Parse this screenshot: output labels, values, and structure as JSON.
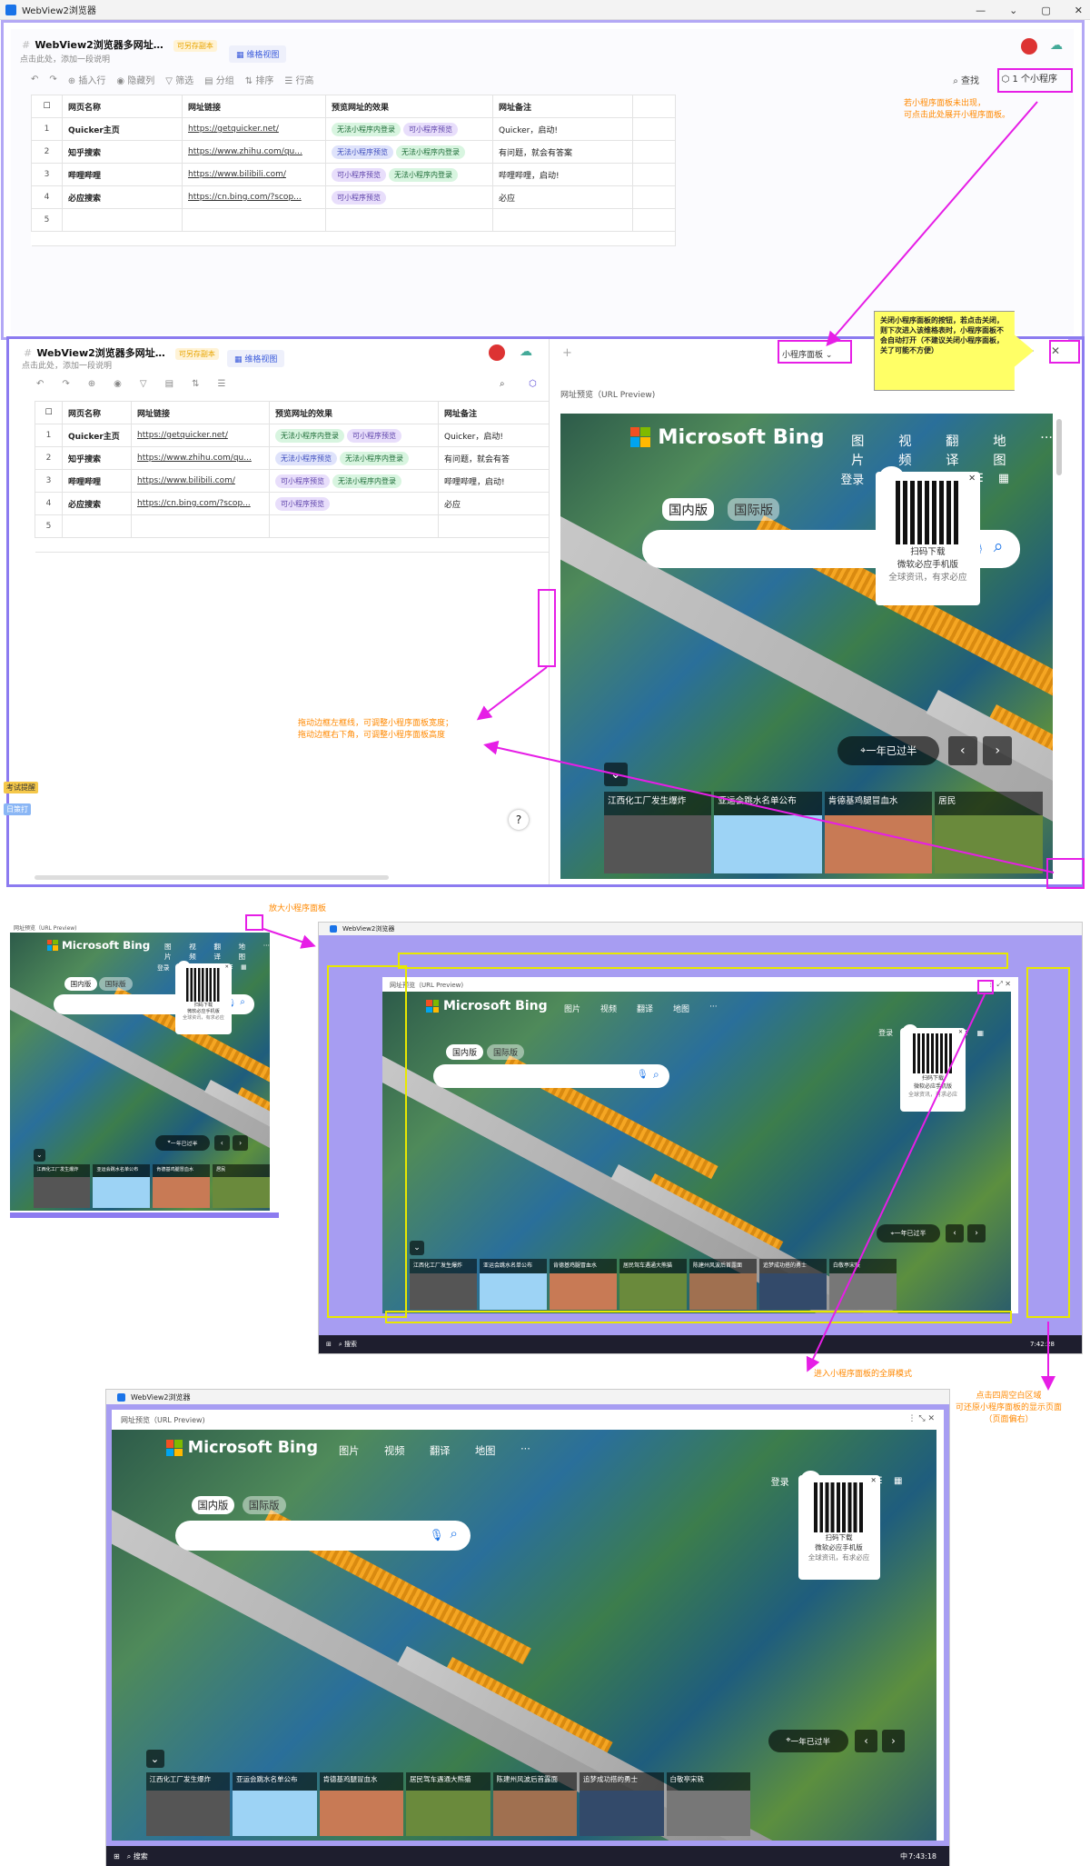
{
  "window": {
    "title": "WebView2浏览器",
    "controls": [
      "—",
      "⌄",
      "▢",
      "✕"
    ]
  },
  "doc": {
    "title": "WebView2浏览器多网址…",
    "title2": "WebView2浏览器多网址…",
    "badge": "可另存副本",
    "subtitle": "点击此处，添加一段说明",
    "view_tab": "维格视图"
  },
  "toolbar": {
    "undo": "↶",
    "redo": "↷",
    "insert_row": "插入行",
    "hide_col": "隐藏列",
    "filter": "筛选",
    "group": "分组",
    "sort": "排序",
    "row_height": "行高",
    "find": "查找",
    "mini_count": "1 个小程序"
  },
  "table": {
    "headers": [
      "网页名称",
      "网址链接",
      "预览网址的效果",
      "网址备注"
    ],
    "rows": [
      {
        "num": "1",
        "name": "Quicker主页",
        "url": "https://getquicker.net/",
        "tags": [
          {
            "t": "无法小程序内登录",
            "c": "green"
          },
          {
            "t": "可小程序预览",
            "c": "purple"
          }
        ],
        "note": "Quicker，启动!"
      },
      {
        "num": "2",
        "name": "知乎搜索",
        "url": "https://www.zhihu.com/qu...",
        "tags": [
          {
            "t": "无法小程序预览",
            "c": "blue"
          },
          {
            "t": "无法小程序内登录",
            "c": "green"
          }
        ],
        "note": "有问题，就会有答案"
      },
      {
        "num": "3",
        "name": "哔哩哔哩",
        "url": "https://www.bilibili.com/",
        "tags": [
          {
            "t": "可小程序预览",
            "c": "purple"
          },
          {
            "t": "无法小程序内登录",
            "c": "green"
          }
        ],
        "note": "哔哩哔哩，启动!"
      },
      {
        "num": "4",
        "name": "必应搜索",
        "url": "https://cn.bing.com/?scop...",
        "tags": [
          {
            "t": "可小程序预览",
            "c": "purple"
          }
        ],
        "note": "必应"
      },
      {
        "num": "5",
        "name": "",
        "url": "",
        "tags": [],
        "note": ""
      }
    ],
    "notes2": [
      "Quicker，启动!",
      "有问题，就会有答",
      "哔哩哔哩，启动!",
      "必应"
    ],
    "url2": [
      "https://getquicker.net/",
      "https://www.zhihu.com/qu...",
      "https://www.bilibili.com/",
      "https://cn.bing.com/?scop..."
    ]
  },
  "annotations": {
    "open_panel": "若小程序面板未出现，\n可点击此处展开小程序面板。",
    "close_panel": "关闭小程序面板的按钮，若点击关闭，则下次进入该维格表时，小程序面板不会自动打开（不建议关闭小程序面板，关了可能不方便）",
    "resize": "拖动边框左框线，可调整小程序面板宽度；\n拖动边框右下角，可调整小程序面板高度",
    "enlarge": "放大小程序面板",
    "fullscreen": "进入小程序面板的全屏模式",
    "restore": "点击四周空白区域\n可还原小程序面板的显示页面\n（页面偏右）"
  },
  "panel": {
    "dropdown": "小程序面板",
    "preview_title": "网址预览（URL Preview)",
    "plus": "+",
    "help": "?"
  },
  "bing": {
    "brand": "Microsoft Bing",
    "nav": [
      "图片",
      "视频",
      "翻译",
      "地图",
      "···"
    ],
    "login": "登录",
    "points": "12",
    "lang_cn": "国内版",
    "lang_intl": "国际版",
    "qr_line1": "扫码下载",
    "qr_line2": "微软必应手机版",
    "qr_line3": "全球资讯，有求必应",
    "location": "一年已过半",
    "news": [
      "江西化工厂发生爆炸",
      "亚运会跳水名单公布",
      "肯德基鸡腿冒血水",
      "居民"
    ],
    "news_full": [
      "江西化工厂发生爆炸",
      "亚运会跳水名单公布",
      "肯德基鸡腿冒血水",
      "居民驾车遇通大熊猫",
      "陈建州风波后首露面",
      "追梦成功搭的勇士",
      "白敬亭宋轶"
    ]
  },
  "side": {
    "tag1": "考试提醒",
    "tag2": "日策打"
  },
  "taskbar": {
    "search": "搜索",
    "time1": "7:42:28",
    "time2": "7:43:18",
    "lang": "中"
  },
  "colors": {
    "purple_frame": "#8c7bf0",
    "magenta": "#e61ee6",
    "note": "#ff8800",
    "yellow": "#e8e800"
  }
}
